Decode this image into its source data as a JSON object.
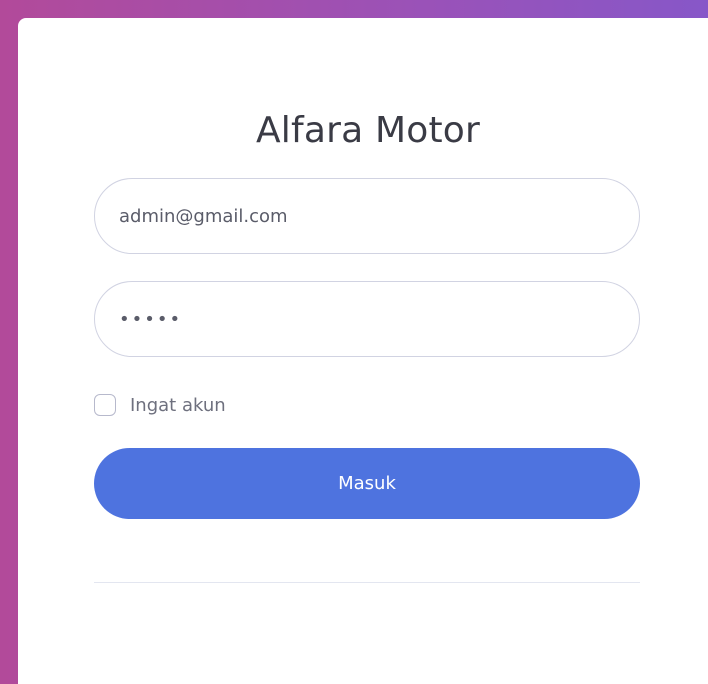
{
  "login": {
    "title": "Alfara Motor",
    "email_value": "admin@gmail.com",
    "password_value": "admin",
    "remember_label": "Ingat akun",
    "remember_checked": false,
    "submit_label": "Masuk"
  },
  "colors": {
    "background_gradient_start": "#b24a9a",
    "background_gradient_end": "#8757c8",
    "primary_button": "#4e73df",
    "card": "#ffffff"
  }
}
